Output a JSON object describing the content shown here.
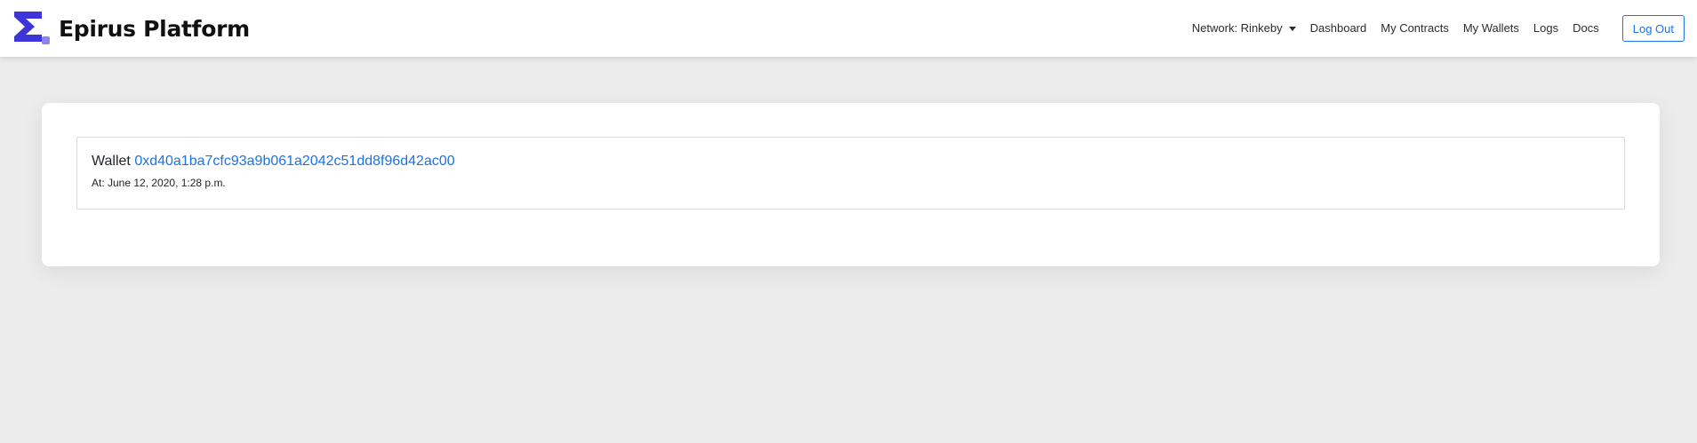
{
  "app": {
    "name": "Epirus Platform",
    "logo_icon": "epirus-logo-icon"
  },
  "nav": {
    "network_label": "Network: Rinkeby",
    "items": [
      {
        "label": "Dashboard"
      },
      {
        "label": "My Contracts"
      },
      {
        "label": "My Wallets"
      },
      {
        "label": "Logs"
      },
      {
        "label": "Docs"
      }
    ],
    "logout_label": "Log Out"
  },
  "wallet": {
    "prefix": "Wallet",
    "address": "0xd40a1ba7cfc93a9b061a2042c51dd8f96d42ac00",
    "date": "At: June 12, 2020, 1:28 p.m."
  },
  "colors": {
    "accent": "#1a73e8",
    "logo_primary": "#3d35d9",
    "logo_secondary": "#8b84f4",
    "background": "#ececec"
  }
}
